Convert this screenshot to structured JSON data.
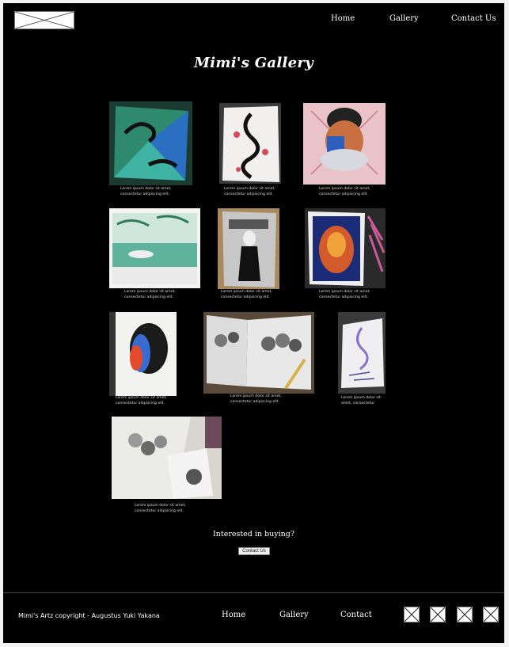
{
  "header": {
    "logo_icon": "image-placeholder-icon",
    "nav": [
      "Home",
      "Gallery",
      "Contact Us"
    ]
  },
  "page_title": "Mimi's Gallery",
  "gallery": {
    "items": [
      {
        "subject": "lizards",
        "caption_1": "Lorem ipsum dolor sit amet,",
        "caption_2": "consectetur adipiscing elit."
      },
      {
        "subject": "dragon",
        "caption_1": "Lorem ipsum dolor sit amet,",
        "caption_2": "consectetur adipiscing elit."
      },
      {
        "subject": "portrait-covered-mouth",
        "caption_1": "Lorem ipsum dolor sit amet,",
        "caption_2": "consectetur adipiscing elit."
      },
      {
        "subject": "palm-boat",
        "caption_1": "Lorem ipsum dolor sit amet,",
        "caption_2": "consectetur adipiscing elit."
      },
      {
        "subject": "figure-sketch",
        "caption_1": "Lorem ipsum dolor sit amet,",
        "caption_2": "consectetur adipiscing elit."
      },
      {
        "subject": "portrait-colored",
        "caption_1": "Lorem ipsum dolor sit amet,",
        "caption_2": "consectetur adipiscing elit."
      },
      {
        "subject": "portrait-profile",
        "caption_1": "Lorem ipsum dolor sit amet,",
        "caption_2": "consectetur adipiscing elit."
      },
      {
        "subject": "fruit-bowl-sketch",
        "caption_1": "Lorem ipsum dolor sit amet,",
        "caption_2": "consectetur adipiscing elit."
      },
      {
        "subject": "snake-doodle",
        "caption_1": "Lorem ipsum dolor sit",
        "caption_2": "amet, consectetur"
      },
      {
        "subject": "fruit-bowl-photo",
        "caption_1": "Lorem ipsum dolor sit amet,",
        "caption_2": "consectetur adipiscing elit."
      }
    ]
  },
  "cta": {
    "title": "Interested in buying?",
    "button": "Contact Us"
  },
  "footer": {
    "copyright": "Mimi's Artz copyright - Augustus Yuki Yakana",
    "nav": [
      "Home",
      "Gallery",
      "Contact"
    ],
    "social_icons": [
      "image-placeholder-icon",
      "image-placeholder-icon",
      "image-placeholder-icon",
      "image-placeholder-icon"
    ]
  },
  "colors": {
    "background": "#000000",
    "text": "#ffffff"
  }
}
